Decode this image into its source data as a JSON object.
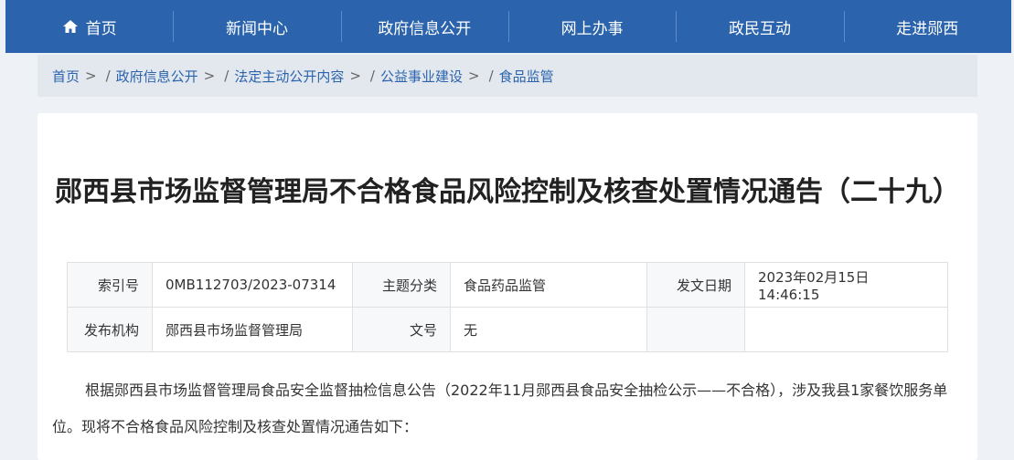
{
  "nav": {
    "items": [
      "首页",
      "新闻中心",
      "政府信息公开",
      "网上办事",
      "政民互动",
      "走进郧西"
    ]
  },
  "breadcrumb": {
    "items": [
      "首页",
      "政府信息公开",
      "法定主动公开内容",
      "公益事业建设",
      "食品监管"
    ],
    "separator": ">",
    "divider": "/"
  },
  "article": {
    "title": "郧西县市场监督管理局不合格食品风险控制及核查处置情况通告（二十九）",
    "meta": {
      "index_label": "索引号",
      "index_value": "0MB112703/2023-07314",
      "topic_label": "主题分类",
      "topic_value": "食品药品监管",
      "date_label": "发文日期",
      "date_value": "2023年02月15日 14:46:15",
      "org_label": "发布机构",
      "org_value": "郧西县市场监督管理局",
      "docno_label": "文号",
      "docno_value": "无"
    },
    "paragraph": "根据郧西县市场监督管理局食品安全监督抽检信息公告（2022年11月郧西县食品安全抽检公示——不合格），涉及我县1家餐饮服务单位。现将不合格食品风险控制及核查处置情况通告如下："
  },
  "colors": {
    "nav_bg": "#2b64ad",
    "link": "#2b64ad"
  },
  "icons": {
    "home": "home-icon"
  }
}
